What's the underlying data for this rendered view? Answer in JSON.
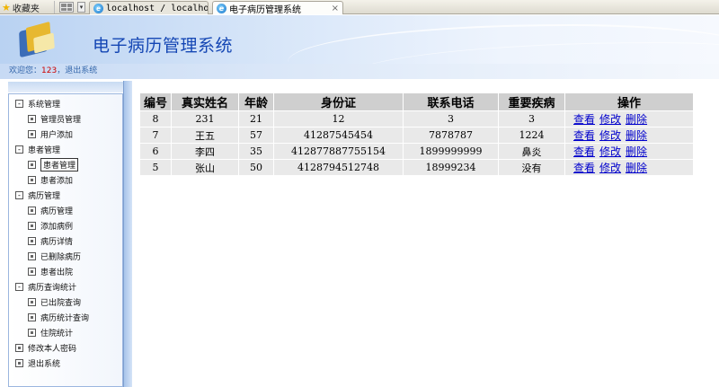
{
  "browser": {
    "favorites_label": "收藏夹",
    "tabs": [
      {
        "title": "localhost / localhost ..."
      },
      {
        "title": "电子病历管理系统"
      }
    ],
    "close_glyph": "×"
  },
  "header": {
    "title": "电子病历管理系统",
    "welcome_prefix": "欢迎您：",
    "username": "123",
    "comma": "，",
    "logout_link": "退出系统"
  },
  "sidebar": {
    "items": [
      {
        "label": "系统管理",
        "level": 0,
        "box": "-"
      },
      {
        "label": "管理员管理",
        "level": 1,
        "box": ""
      },
      {
        "label": "用户添加",
        "level": 1,
        "box": ""
      },
      {
        "label": "患者管理",
        "level": 0,
        "box": "-"
      },
      {
        "label": "患者管理",
        "level": 1,
        "box": "",
        "selected": true
      },
      {
        "label": "患者添加",
        "level": 1,
        "box": ""
      },
      {
        "label": "病历管理",
        "level": 0,
        "box": "-"
      },
      {
        "label": "病历管理",
        "level": 1,
        "box": ""
      },
      {
        "label": "添加病例",
        "level": 1,
        "box": ""
      },
      {
        "label": "病历详情",
        "level": 1,
        "box": ""
      },
      {
        "label": "已删除病历",
        "level": 1,
        "box": ""
      },
      {
        "label": "患者出院",
        "level": 1,
        "box": ""
      },
      {
        "label": "病历查询统计",
        "level": 0,
        "box": "-"
      },
      {
        "label": "已出院查询",
        "level": 1,
        "box": ""
      },
      {
        "label": "病历统计查询",
        "level": 1,
        "box": ""
      },
      {
        "label": "住院统计",
        "level": 1,
        "box": ""
      },
      {
        "label": "修改本人密码",
        "level": 0,
        "box": ""
      },
      {
        "label": "退出系统",
        "level": 0,
        "box": ""
      }
    ]
  },
  "table": {
    "headers": [
      "编号",
      "真实姓名",
      "年龄",
      "身份证",
      "联系电话",
      "重要疾病",
      "操作"
    ],
    "rows": [
      {
        "id": "8",
        "name": "231",
        "age": "21",
        "id_card": "12",
        "phone": "3",
        "disease": "3"
      },
      {
        "id": "7",
        "name": "王五",
        "age": "57",
        "id_card": "41287545454",
        "phone": "7878787",
        "disease": "1224"
      },
      {
        "id": "6",
        "name": "李四",
        "age": "35",
        "id_card": "412877887755154",
        "phone": "1899999999",
        "disease": "鼻炎"
      },
      {
        "id": "5",
        "name": "张山",
        "age": "50",
        "id_card": "4128794512748",
        "phone": "18999234",
        "disease": "没有"
      }
    ],
    "actions": {
      "view": "查看",
      "edit": "修改",
      "delete": "删除"
    }
  }
}
